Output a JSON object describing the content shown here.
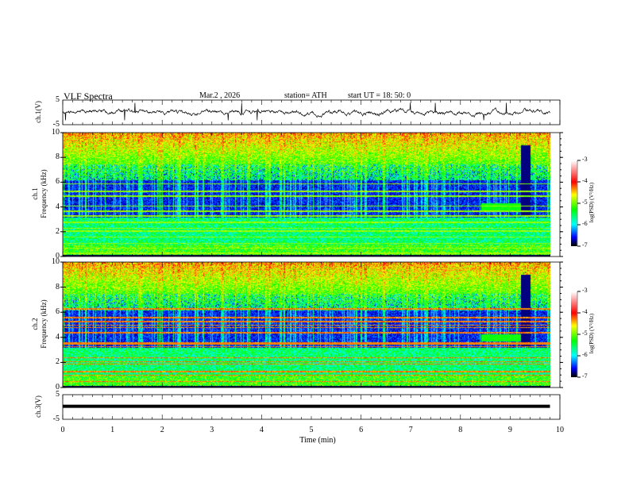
{
  "header": {
    "title": "VLF  Spectra",
    "date": "Mar.2  , 2026",
    "station": "station= ATH",
    "start": "start  UT  =    18: 50: 0"
  },
  "chart_data": [
    {
      "type": "line",
      "ylabel": "ch.1(V)",
      "xlim": [
        0,
        10
      ],
      "ylim": [
        -5,
        5
      ],
      "yticks": [
        "5",
        "-5"
      ],
      "description_values": {
        "mean_level": 0,
        "noise_range": [
          -1,
          1
        ],
        "data_end_min": 9.8
      }
    },
    {
      "type": "heatmap",
      "ylabel": "ch.1\nFrequency (kHz)",
      "ylabel_lines": [
        "ch.1",
        "Frequency (kHz)"
      ],
      "xlim": [
        0,
        10
      ],
      "ylim": [
        0,
        10
      ],
      "yticks": [
        "0",
        "2",
        "4",
        "6",
        "8",
        "10"
      ],
      "colorbar": {
        "label": "log(PSD) (V²/Hz)",
        "range": [
          -7,
          -3
        ],
        "ticks": [
          "-3",
          "-4",
          "-5",
          "-6",
          "-7"
        ],
        "colormap": [
          "#000000",
          "#0000ff",
          "#00ffff",
          "#00ff00",
          "#ffff00",
          "#ff0000",
          "#ffffff"
        ]
      }
    },
    {
      "type": "heatmap",
      "ylabel_lines": [
        "ch.2",
        "Frequency (kHz)"
      ],
      "xlim": [
        0,
        10
      ],
      "ylim": [
        0,
        10
      ],
      "yticks": [
        "0",
        "2",
        "4",
        "6",
        "8",
        "10"
      ],
      "colorbar": {
        "label": "log(PSD) (V²/Hz)",
        "range": [
          -7,
          -3
        ],
        "ticks": [
          "-3",
          "-4",
          "-5",
          "-6",
          "-7"
        ]
      }
    },
    {
      "type": "line",
      "ylabel": "ch.3(V)",
      "xlim": [
        0,
        10
      ],
      "ylim": [
        -5,
        5
      ],
      "yticks": [
        "5",
        "-5"
      ],
      "xlabel": "Time  (min)",
      "xticks": [
        "0",
        "1",
        "2",
        "3",
        "4",
        "5",
        "6",
        "7",
        "8",
        "9",
        "10"
      ],
      "description_values": {
        "mean_level": 0.3
      }
    }
  ]
}
